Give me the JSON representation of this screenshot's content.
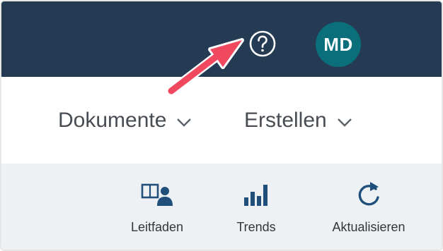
{
  "header": {
    "help_icon": "question-circle-icon",
    "avatar_initials": "MD",
    "avatar_color": "#0a6f7a",
    "bar_color": "#243b53"
  },
  "menu": {
    "items": [
      {
        "label": "Dokumente",
        "icon": "chevron-down-icon"
      },
      {
        "label": "Erstellen",
        "icon": "chevron-down-icon"
      }
    ]
  },
  "toolbar": {
    "items": [
      {
        "label": "Leitfaden",
        "icon": "guide-icon"
      },
      {
        "label": "Trends",
        "icon": "bar-chart-icon"
      },
      {
        "label": "Aktualisieren",
        "icon": "refresh-icon"
      }
    ],
    "accent": "#1f4f7a"
  },
  "annotation": {
    "arrow_color": "#f0485e",
    "target": "help-button"
  }
}
